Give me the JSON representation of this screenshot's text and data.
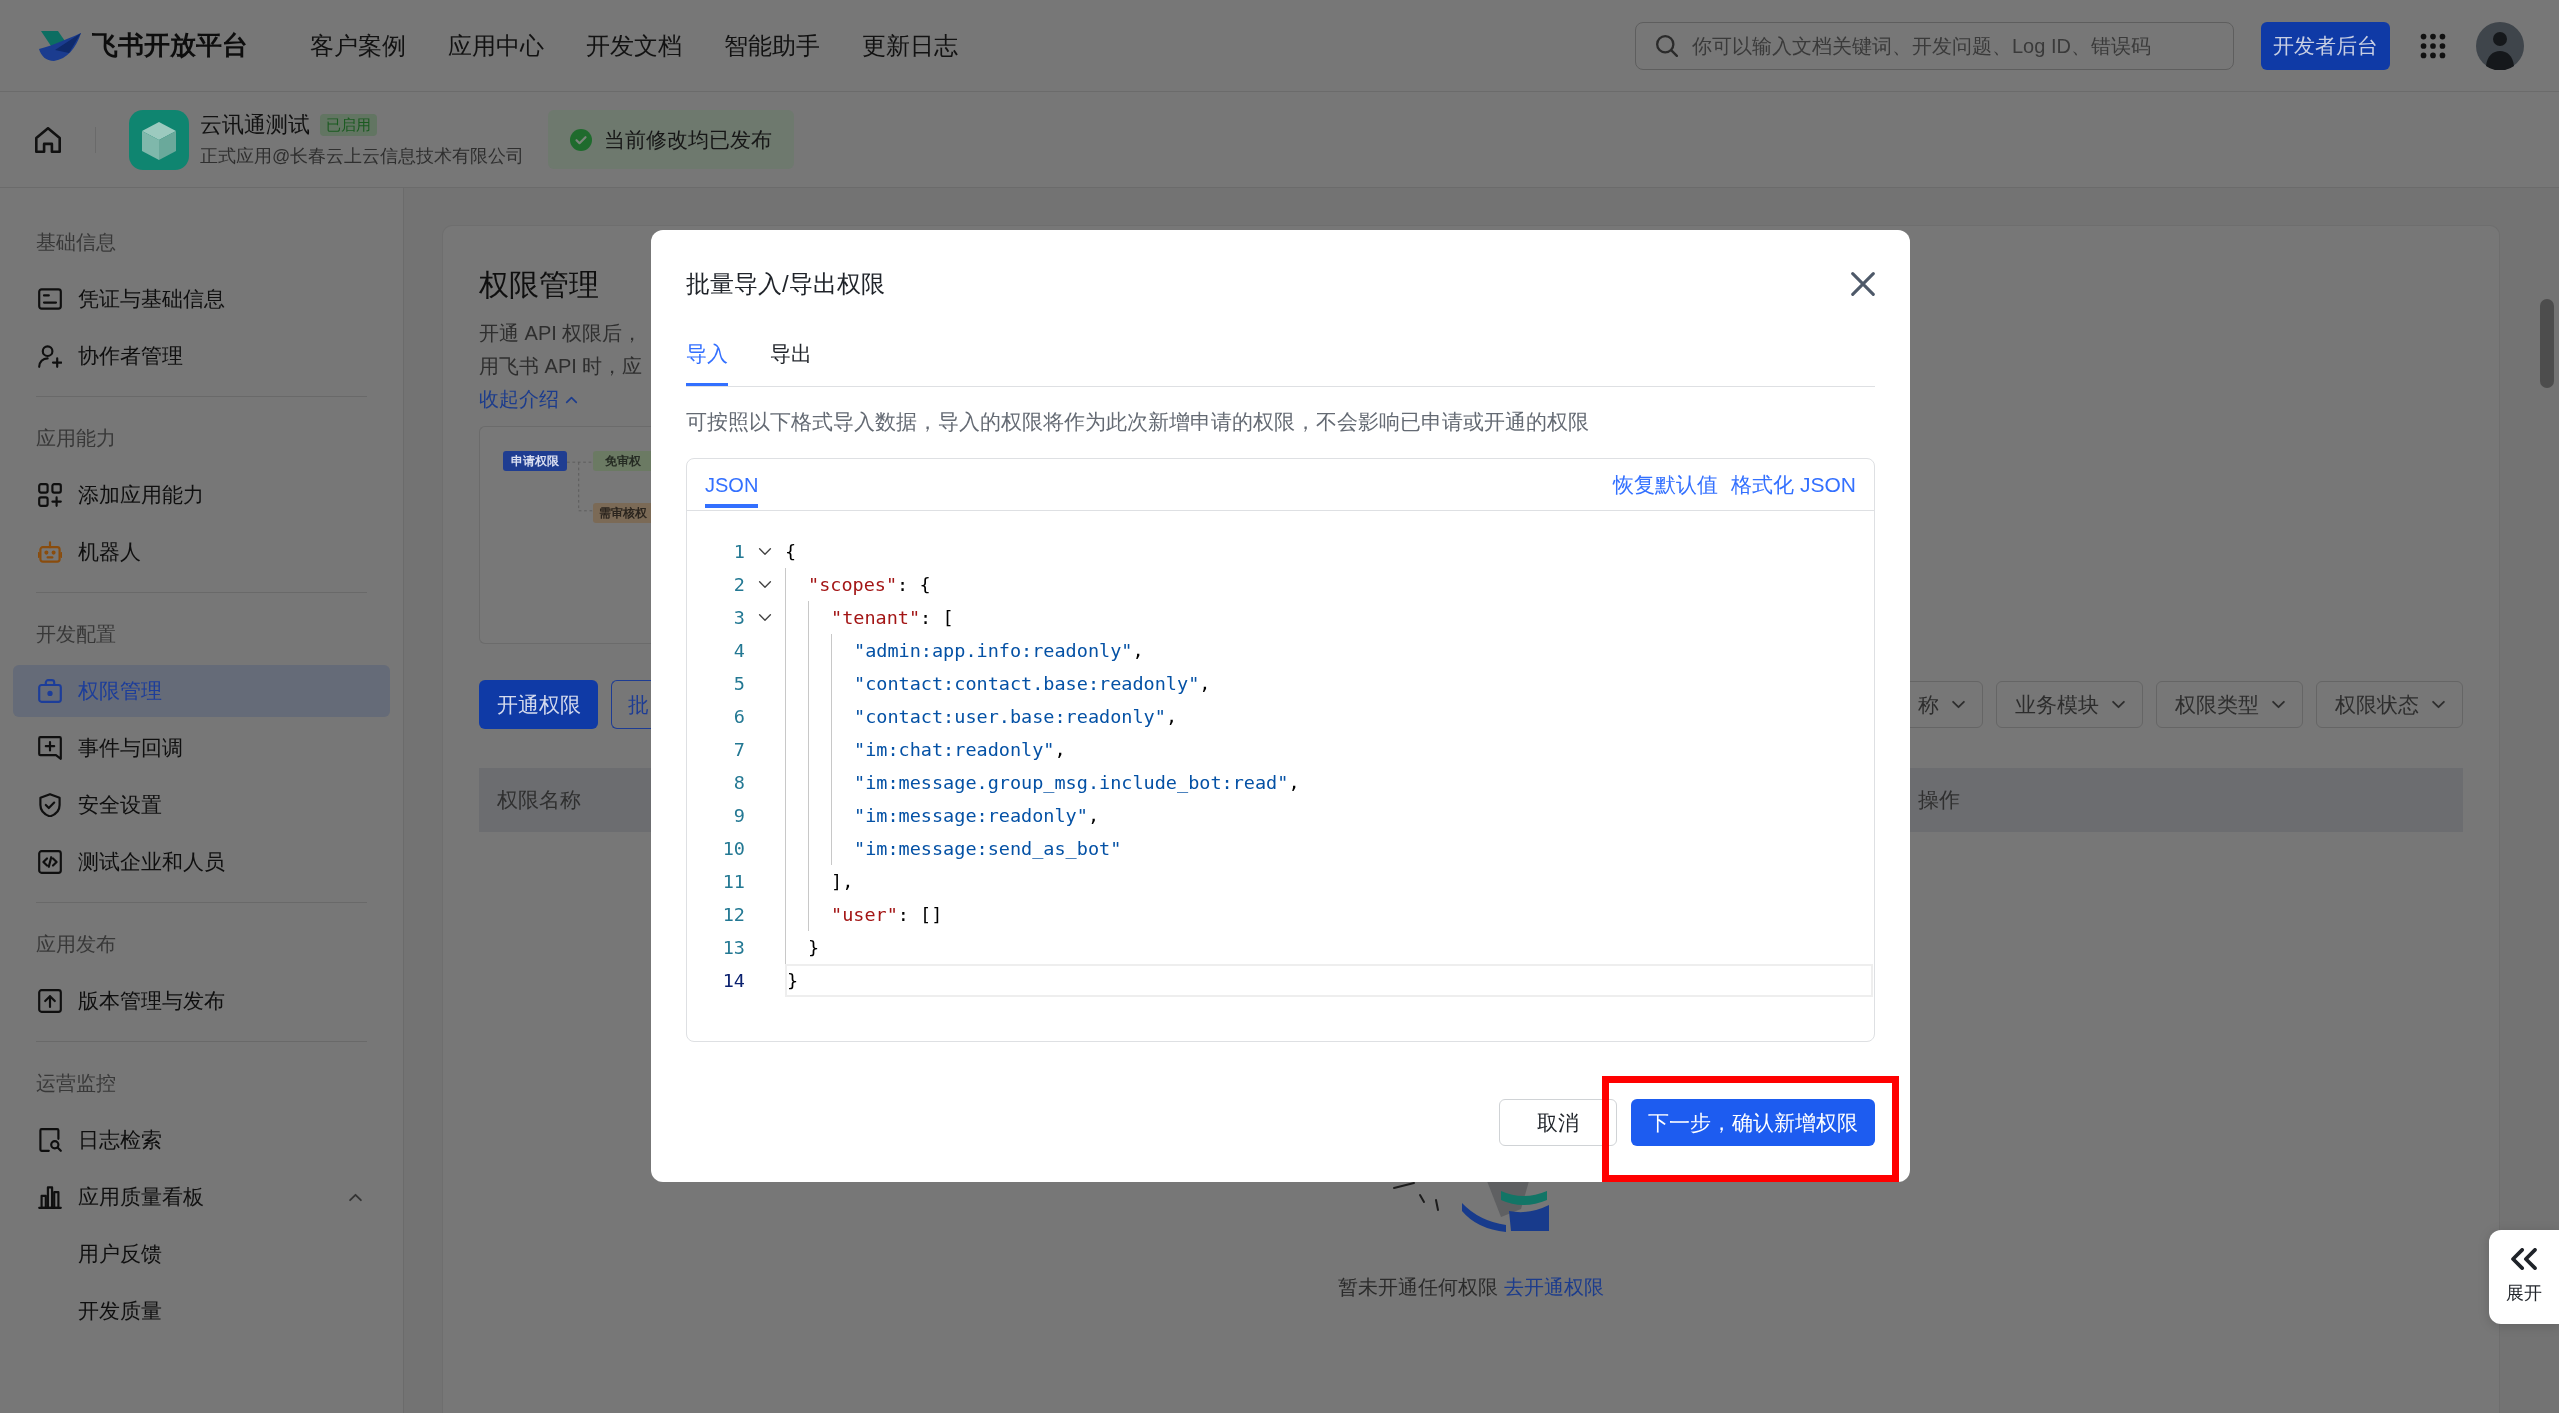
{
  "top_nav": {
    "logo": "飞书开放平台",
    "links": [
      "客户案例",
      "应用中心",
      "开发文档",
      "智能助手",
      "更新日志"
    ],
    "search": {
      "placeholder": "你可以输入文档关键词、开发问题、Log ID、错误码"
    },
    "console_button": "开发者后台"
  },
  "app_bar": {
    "app_name": "云讯通测试",
    "status": "已启用",
    "owner": "正式应用@长春云上云信息技术有限公司",
    "notice": "当前修改均已发布"
  },
  "sidebar": {
    "sections": [
      {
        "title": "基础信息",
        "items": [
          {
            "label": "凭证与基础信息",
            "selected": false
          },
          {
            "label": "协作者管理",
            "selected": false
          }
        ]
      },
      {
        "title": "应用能力",
        "items": [
          {
            "label": "添加应用能力",
            "selected": false
          },
          {
            "label": "机器人",
            "selected": false
          }
        ]
      },
      {
        "title": "开发配置",
        "items": [
          {
            "label": "权限管理",
            "selected": true
          },
          {
            "label": "事件与回调",
            "selected": false
          },
          {
            "label": "安全设置",
            "selected": false
          },
          {
            "label": "测试企业和人员",
            "selected": false
          }
        ]
      },
      {
        "title": "应用发布",
        "items": [
          {
            "label": "版本管理与发布",
            "selected": false
          }
        ]
      },
      {
        "title": "运营监控",
        "items": [
          {
            "label": "日志检索",
            "selected": false
          },
          {
            "label": "应用质量看板",
            "selected": false,
            "expanded": true,
            "children": [
              {
                "label": "用户反馈",
                "selected": false
              },
              {
                "label": "开发质量",
                "selected": false
              }
            ]
          }
        ]
      }
    ]
  },
  "page": {
    "title": "权限管理",
    "description": [
      "开通 API 权限后，",
      "用飞书 API 时，应"
    ],
    "collapse_link": "收起介绍",
    "diagram": {
      "nodes": [
        {
          "label": "申请权限",
          "color": "#1f3d91"
        },
        {
          "label": "免审权",
          "color": "#6b7a63"
        },
        {
          "label": "需审核权",
          "color": "#7b6a56"
        }
      ]
    },
    "toolbar": {
      "buttons": [
        {
          "label": "开通权限",
          "kind": "primary"
        },
        {
          "label": "批",
          "kind": "outline"
        }
      ],
      "filters": [
        "称",
        "业务模块",
        "权限类型",
        "权限状态"
      ]
    },
    "table": {
      "columns": [
        "权限名称",
        "操作"
      ]
    },
    "empty_state": {
      "text": "暂未开通任何权限",
      "link": "去开通权限"
    }
  },
  "expand_panel": {
    "label": "展开"
  },
  "dialog": {
    "title": "批量导入/导出权限",
    "tabs": [
      {
        "label": "导入",
        "selected": true
      },
      {
        "label": "导出",
        "selected": false
      }
    ],
    "hint": "可按照以下格式导入数据，导入的权限将作为此次新增申请的权限，不会影响已申请或开通的权限",
    "editor": {
      "tabs": [
        {
          "label": "JSON",
          "selected": true
        }
      ],
      "actions": [
        "恢复默认值",
        "格式化 JSON"
      ],
      "lines": [
        {
          "number": "1",
          "text": "{",
          "expanded": true,
          "selected": false,
          "children": [
            {
              "number": "2",
              "text": "\"scopes\": {",
              "expanded": true,
              "selected": false,
              "children": [
                {
                  "number": "3",
                  "text": "\"tenant\": [",
                  "expanded": true,
                  "selected": false,
                  "children": [
                    {
                      "number": "4",
                      "text": "\"admin:app.info:readonly\",",
                      "selected": false
                    },
                    {
                      "number": "5",
                      "text": "\"contact:contact.base:readonly\",",
                      "selected": false
                    },
                    {
                      "number": "6",
                      "text": "\"contact:user.base:readonly\",",
                      "selected": false
                    },
                    {
                      "number": "7",
                      "text": "\"im:chat:readonly\",",
                      "selected": false
                    },
                    {
                      "number": "8",
                      "text": "\"im:message.group_msg.include_bot:read\",",
                      "selected": false
                    },
                    {
                      "number": "9",
                      "text": "\"im:message:readonly\",",
                      "selected": false
                    },
                    {
                      "number": "10",
                      "text": "\"im:message:send_as_bot\"",
                      "selected": false
                    }
                  ]
                },
                {
                  "number": "11",
                  "text": "],",
                  "selected": false
                },
                {
                  "number": "12",
                  "text": "\"user\": []",
                  "selected": false
                }
              ]
            },
            {
              "number": "13",
              "text": "}",
              "selected": false
            }
          ]
        },
        {
          "number": "14",
          "text": "}",
          "selected": true
        }
      ]
    },
    "buttons": [
      {
        "label": "取消",
        "kind": "secondary",
        "highlighted": false
      },
      {
        "label": "下一步，确认新增权限",
        "kind": "primary",
        "highlighted": true
      }
    ]
  }
}
